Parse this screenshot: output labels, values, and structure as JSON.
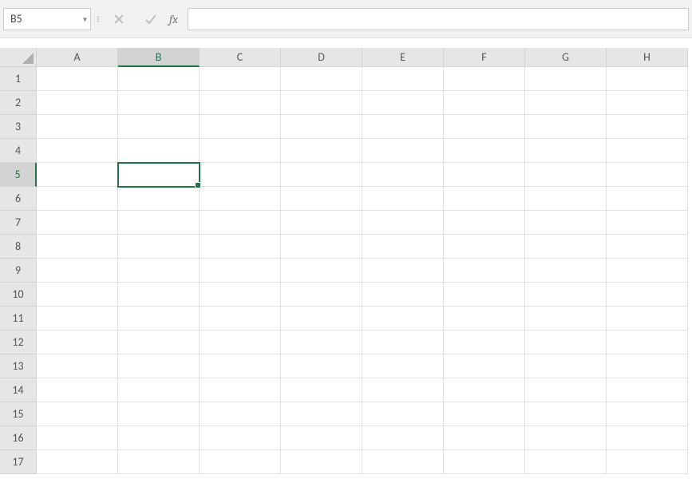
{
  "formula_bar": {
    "name_box_value": "B5",
    "formula_value": "",
    "fx_label": "fx"
  },
  "columns": [
    "A",
    "B",
    "C",
    "D",
    "E",
    "F",
    "G",
    "H"
  ],
  "rows": [
    "1",
    "2",
    "3",
    "4",
    "5",
    "6",
    "7",
    "8",
    "9",
    "10",
    "11",
    "12",
    "13",
    "14",
    "15",
    "16",
    "17"
  ],
  "selected_cell": {
    "col": "B",
    "row": "5"
  },
  "colors": {
    "accent": "#217346",
    "header_bg": "#e6e6e6",
    "grid_line": "#e0e0e0"
  }
}
